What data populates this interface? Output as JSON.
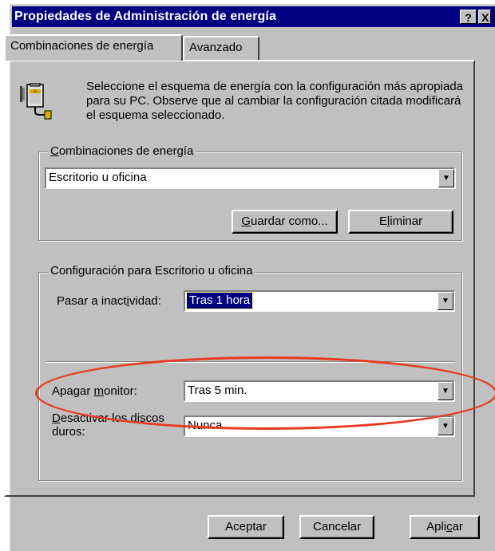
{
  "window": {
    "title": "Propiedades de Administración de energía",
    "help_btn": "?",
    "close_btn": "X"
  },
  "tabs": [
    {
      "label": "Combinaciones de energía",
      "active": true
    },
    {
      "label": "Avanzado",
      "active": false
    }
  ],
  "intro_text": "Seleccione el esquema de energía con la configuración más apropiada para su PC. Observe que al cambiar la configuración citada modificará el esquema seleccionado.",
  "schemes": {
    "group_label": "Combinaciones de energía",
    "selected": "Escritorio u oficina",
    "save_as_label": "Guardar como...",
    "delete_label": "Eliminar"
  },
  "settings": {
    "group_label": "Configuración para Escritorio u oficina",
    "standby_label": "Pasar a inactividad:",
    "standby_value": "Tras 1 hora",
    "monitor_label": "Apagar monitor:",
    "monitor_value": "Tras 5 min.",
    "disks_label": "Desactivar los discos duros:",
    "disks_value": "Nunca"
  },
  "footer": {
    "ok_label": "Aceptar",
    "cancel_label": "Cancelar",
    "apply_label": "Aplicar"
  },
  "colors": {
    "titlebar": "#000080",
    "face": "#c0c0c0",
    "highlight_ellipse": "#e83a1e"
  }
}
